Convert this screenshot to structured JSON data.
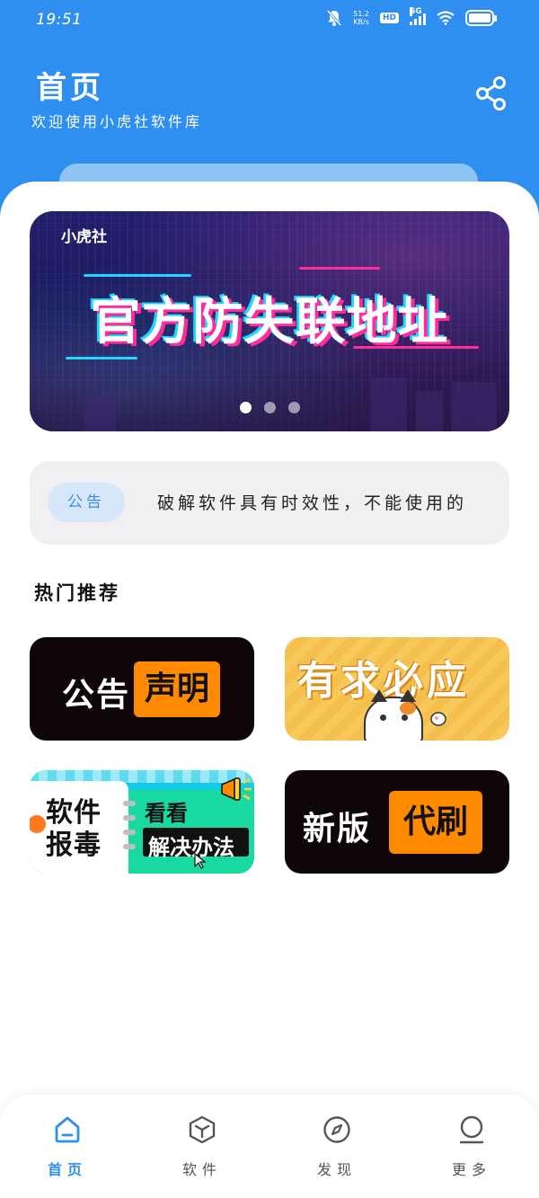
{
  "status_bar": {
    "time": "19:51",
    "speed_value": "51.2",
    "speed_unit": "KB/s",
    "hd": "HD",
    "network": "5G"
  },
  "header": {
    "title": "首页",
    "subtitle": "欢迎使用小虎社软件库",
    "share_icon": "share-icon"
  },
  "banner": {
    "brand": "小虎社",
    "title": "官方防失联地址",
    "slide_count": 3,
    "active_slide": 0
  },
  "notice": {
    "badge": "公告",
    "text": "破解软件具有时效性，不能使用的"
  },
  "hot": {
    "title": "热门推荐",
    "tiles": [
      {
        "left_text": "公告",
        "box_text": "声明"
      },
      {
        "title": "有求必应"
      },
      {
        "line1": "软件",
        "line2": "报毒",
        "right1": "看看",
        "right2": "解决办法"
      },
      {
        "left_text": "新版",
        "box_text": "代刷"
      }
    ]
  },
  "nav": {
    "items": [
      {
        "label": "首页",
        "icon": "home-icon",
        "active": true
      },
      {
        "label": "软件",
        "icon": "cube-icon",
        "active": false
      },
      {
        "label": "发现",
        "icon": "compass-icon",
        "active": false
      },
      {
        "label": "更多",
        "icon": "user-icon",
        "active": false
      }
    ]
  },
  "colors": {
    "primary": "#2f8ff0",
    "accent_orange": "#ff8a00",
    "notice_bg": "#f0f0f2"
  }
}
